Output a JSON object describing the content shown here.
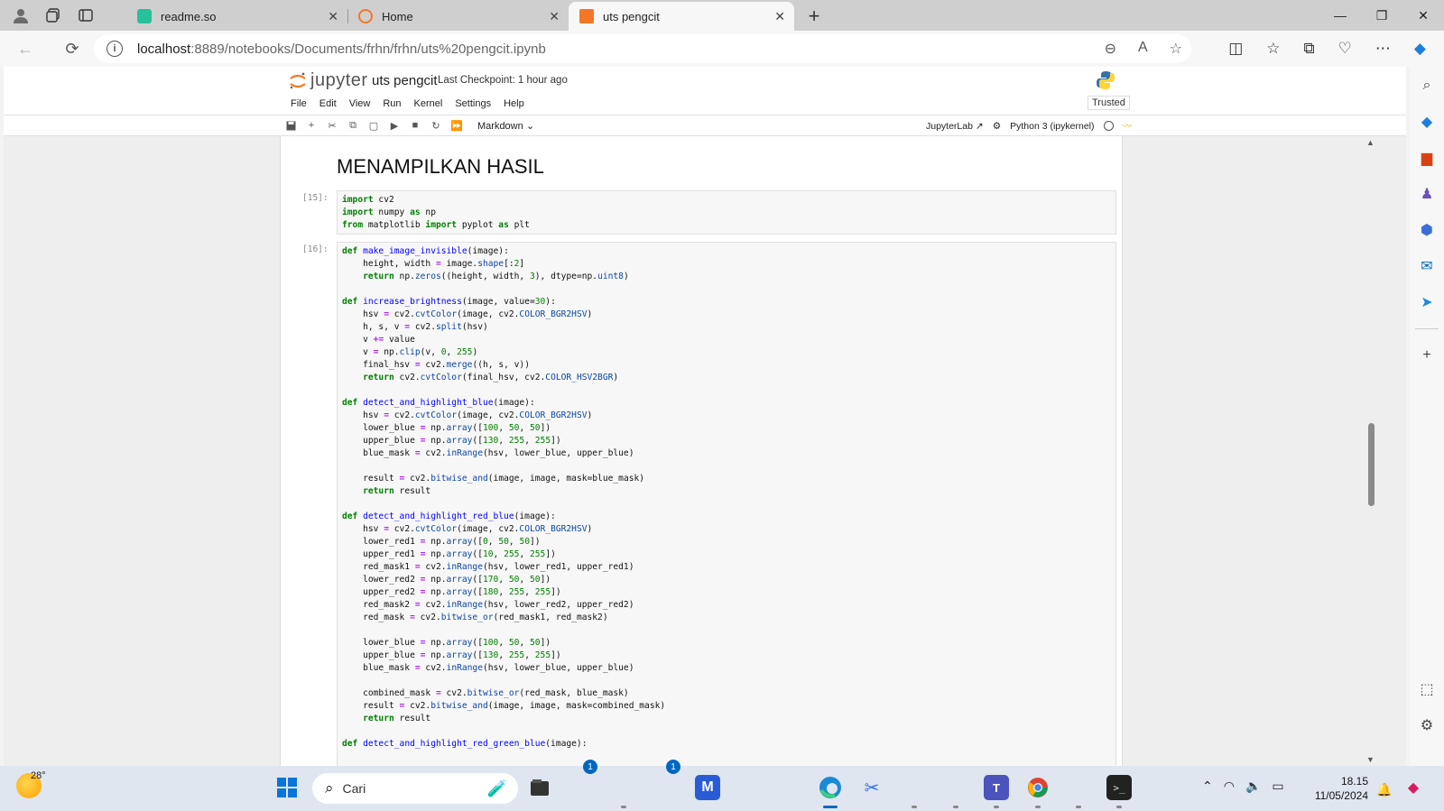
{
  "browser": {
    "tabs": [
      {
        "title": "readme.so",
        "favicon_color": "#27c19a"
      },
      {
        "title": "Home",
        "favicon_color": "#f37726"
      },
      {
        "title": "uts pengcit",
        "favicon_color": "#f37726",
        "active": true
      }
    ],
    "new_tab_label": "+",
    "url_host": "localhost",
    "url_rest": ":8889/notebooks/Documents/frhn/frhn/uts%20pengcit.ipynb"
  },
  "jupyter": {
    "logo_text": "jupyter",
    "notebook_title": "uts pengcit",
    "checkpoint": "Last Checkpoint: 1 hour ago",
    "menu": [
      "File",
      "Edit",
      "View",
      "Run",
      "Kernel",
      "Settings",
      "Help"
    ],
    "trusted": "Trusted",
    "cell_type": "Markdown",
    "jupyterlab_label": "JupyterLab",
    "kernel": "Python 3 (ipykernel)",
    "accent_color": "#f37726"
  },
  "notebook": {
    "heading": "MENAMPILKAN HASIL",
    "cells": [
      {
        "prompt": "[15]:",
        "code": "import cv2\nimport numpy as np\nfrom matplotlib import pyplot as plt"
      },
      {
        "prompt": "[16]:",
        "code": "def make_image_invisible(image):\n    height, width = image.shape[:2]\n    return np.zeros((height, width, 3), dtype=np.uint8)\n\ndef increase_brightness(image, value=30):\n    hsv = cv2.cvtColor(image, cv2.COLOR_BGR2HSV)\n    h, s, v = cv2.split(hsv)\n    v += value\n    v = np.clip(v, 0, 255)\n    final_hsv = cv2.merge((h, s, v))\n    return cv2.cvtColor(final_hsv, cv2.COLOR_HSV2BGR)\n\ndef detect_and_highlight_blue(image):\n    hsv = cv2.cvtColor(image, cv2.COLOR_BGR2HSV)\n    lower_blue = np.array([100, 50, 50])\n    upper_blue = np.array([130, 255, 255])\n    blue_mask = cv2.inRange(hsv, lower_blue, upper_blue)\n\n    result = cv2.bitwise_and(image, image, mask=blue_mask)\n    return result\n\ndef detect_and_highlight_red_blue(image):\n    hsv = cv2.cvtColor(image, cv2.COLOR_BGR2HSV)\n    lower_red1 = np.array([0, 50, 50])\n    upper_red1 = np.array([10, 255, 255])\n    red_mask1 = cv2.inRange(hsv, lower_red1, upper_red1)\n    lower_red2 = np.array([170, 50, 50])\n    upper_red2 = np.array([180, 255, 255])\n    red_mask2 = cv2.inRange(hsv, lower_red2, upper_red2)\n    red_mask = cv2.bitwise_or(red_mask1, red_mask2)\n\n    lower_blue = np.array([100, 50, 50])\n    upper_blue = np.array([130, 255, 255])\n    blue_mask = cv2.inRange(hsv, lower_blue, upper_blue)\n\n    combined_mask = cv2.bitwise_or(red_mask, blue_mask)\n    result = cv2.bitwise_and(image, image, mask=combined_mask)\n    return result\n\ndef detect_and_highlight_red_green_blue(image):"
      }
    ]
  },
  "taskbar": {
    "temperature": "28°",
    "search_placeholder": "Cari",
    "badge_count_a": "1",
    "badge_count_b": "1",
    "time": "18.15",
    "date": "11/05/2024"
  }
}
